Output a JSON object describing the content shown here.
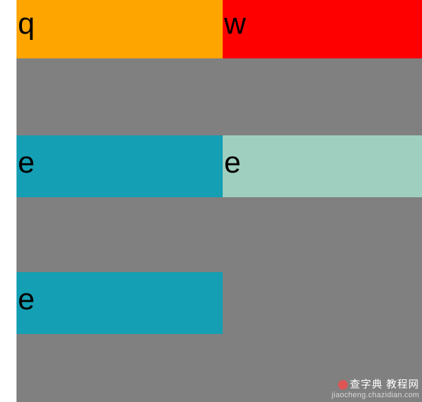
{
  "cells": {
    "q": "q",
    "w": "w",
    "e1": "e",
    "e2": "e",
    "e3": "e"
  },
  "watermark": {
    "line1": "查字典 教程网",
    "line2": "jiaocheng.chazidian.com"
  }
}
